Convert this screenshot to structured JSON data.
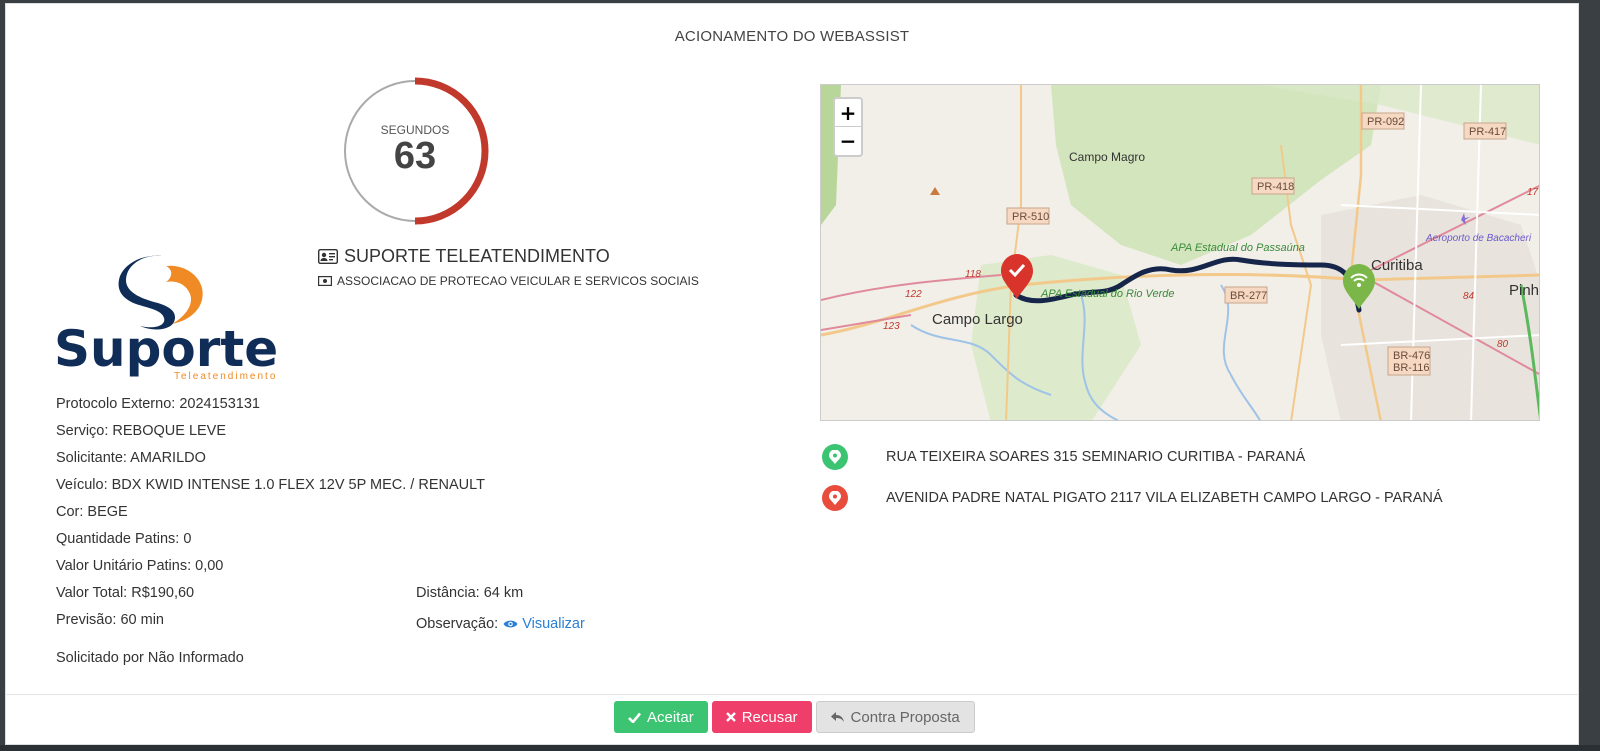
{
  "modal": {
    "title": "ACIONAMENTO DO WEBASSIST"
  },
  "timer": {
    "label": "SEGUNDOS",
    "value": "63",
    "fraction_remaining": 0.5
  },
  "company": {
    "name": "SUPORTE TELEATENDIMENTO",
    "subtitle": "ASSOCIACAO DE PROTECAO VEICULAR E SERVICOS SOCIAIS",
    "name_icon": "id-card-icon",
    "subtitle_icon": "money-icon"
  },
  "logo": {
    "wordmark": "Suporte",
    "tagline": "Teleatendimento"
  },
  "details": {
    "protocolo": "Protocolo Externo: 2024153131",
    "servico": "Serviço: REBOQUE LEVE",
    "solicitante": "Solicitante: AMARILDO",
    "veiculo": "Veículo: BDX KWID INTENSE 1.0 FLEX 12V 5P MEC. / RENAULT",
    "cor": "Cor: BEGE",
    "patins": "Quantidade Patins: 0",
    "valor_unitario": "Valor Unitário Patins: 0,00",
    "valor_total": "Valor Total: R$190,60",
    "previsao": "Previsão: 60 min",
    "solicitado_por": "Solicitado por Não Informado",
    "distancia": "Distância: 64 km",
    "observacao_label": "Observação:",
    "observacao_link": "Visualizar"
  },
  "map": {
    "zoom_in": "+",
    "zoom_out": "−",
    "labels": {
      "campo_magro": "Campo Magro",
      "campo_largo": "Campo Largo",
      "curitiba": "Curitiba",
      "pinh": "Pinh",
      "apa_passauna": "APA Estadual do Passaúna",
      "apa_rio_verde": "APA Estadual do Rio Verde",
      "aeroporto": "Aeroporto de Bacacheri",
      "pr092": "PR-092",
      "pr417": "PR-417",
      "pr418": "PR-418",
      "pr510": "PR-510",
      "br277": "BR-277",
      "br476": "BR-476",
      "br116": "BR-116",
      "n118": "118",
      "n122": "122",
      "n123": "123",
      "n84": "84",
      "n80": "80",
      "n17": "17"
    }
  },
  "addresses": {
    "origin": "RUA TEIXEIRA SOARES 315 SEMINARIO CURITIBA - PARANÁ",
    "destination": "AVENIDA PADRE NATAL PIGATO 2117 VILA ELIZABETH CAMPO LARGO - PARANÁ"
  },
  "buttons": {
    "accept": "Aceitar",
    "refuse": "Recusar",
    "counter": "Contra Proposta"
  },
  "colors": {
    "accent_green": "#3cc472",
    "accent_red": "#f03e6a",
    "timer_red": "#c0392b",
    "route": "#1b2a4a",
    "logo_navy": "#0f2d57",
    "logo_orange": "#f08a24"
  }
}
